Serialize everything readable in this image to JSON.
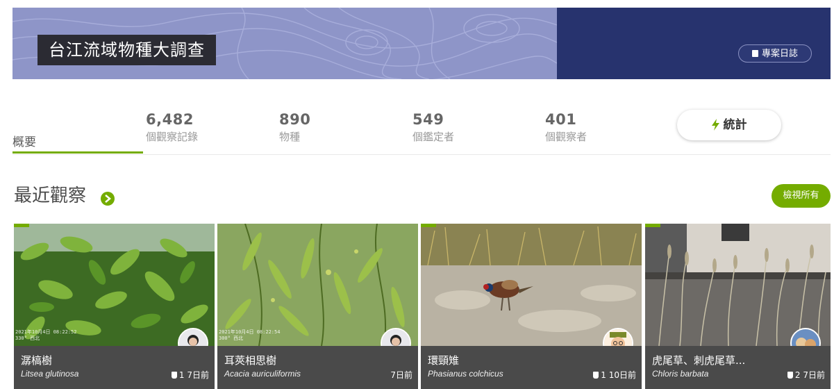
{
  "project": {
    "title": "台江流域物種大調查",
    "journal_label": "專案日誌"
  },
  "stats": {
    "overview_tab": "概要",
    "observations": {
      "value": "6,482",
      "label": "個觀察記錄"
    },
    "species": {
      "value": "890",
      "label": "物種"
    },
    "identifiers": {
      "value": "549",
      "label": "個鑑定者"
    },
    "observers": {
      "value": "401",
      "label": "個觀察者"
    },
    "stats_button": "統計"
  },
  "recent": {
    "title": "最近觀察",
    "view_all": "檢視所有",
    "cards": [
      {
        "common": "潺槁樹",
        "sci": "Litsea glutinosa",
        "ids": "1",
        "when": "7日前",
        "stamp": "2021年10月4日 08:22:52\n330° 西北"
      },
      {
        "common": "耳莢相思樹",
        "sci": "Acacia auriculiformis",
        "ids": "",
        "when": "7日前",
        "stamp": "2021年10月4日 08:22:54\n300° 西北"
      },
      {
        "common": "環頸雉",
        "sci": "Phasianus colchicus",
        "ids": "1",
        "when": "10日前",
        "stamp": ""
      },
      {
        "common": "虎尾草、刺虎尾草...",
        "sci": "Chloris barbata",
        "ids": "2",
        "when": "7日前",
        "stamp": ""
      }
    ]
  },
  "colors": {
    "accent": "#74ac00",
    "banner": "#27336e",
    "banner_art": "#8e95c8",
    "caption": "#4a4a4a"
  }
}
